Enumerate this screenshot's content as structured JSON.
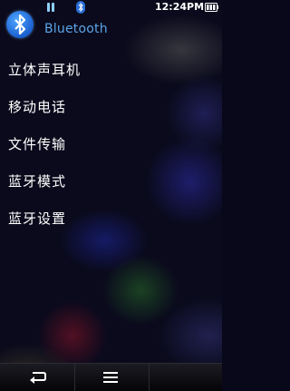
{
  "statusbar": {
    "time": "12:24PM",
    "icons": [
      "pause-icon",
      "bluetooth-status-icon",
      "battery-icon"
    ]
  },
  "header": {
    "title": "Bluetooth",
    "icon": "bluetooth-icon",
    "accent": "#5aa4e8"
  },
  "menu": {
    "items": [
      {
        "label": "立体声耳机"
      },
      {
        "label": "移动电话"
      },
      {
        "label": "文件传输"
      },
      {
        "label": "蓝牙模式"
      },
      {
        "label": "蓝牙设置"
      }
    ]
  },
  "bottombar": {
    "buttons": [
      "back-icon",
      "menu-icon"
    ]
  }
}
